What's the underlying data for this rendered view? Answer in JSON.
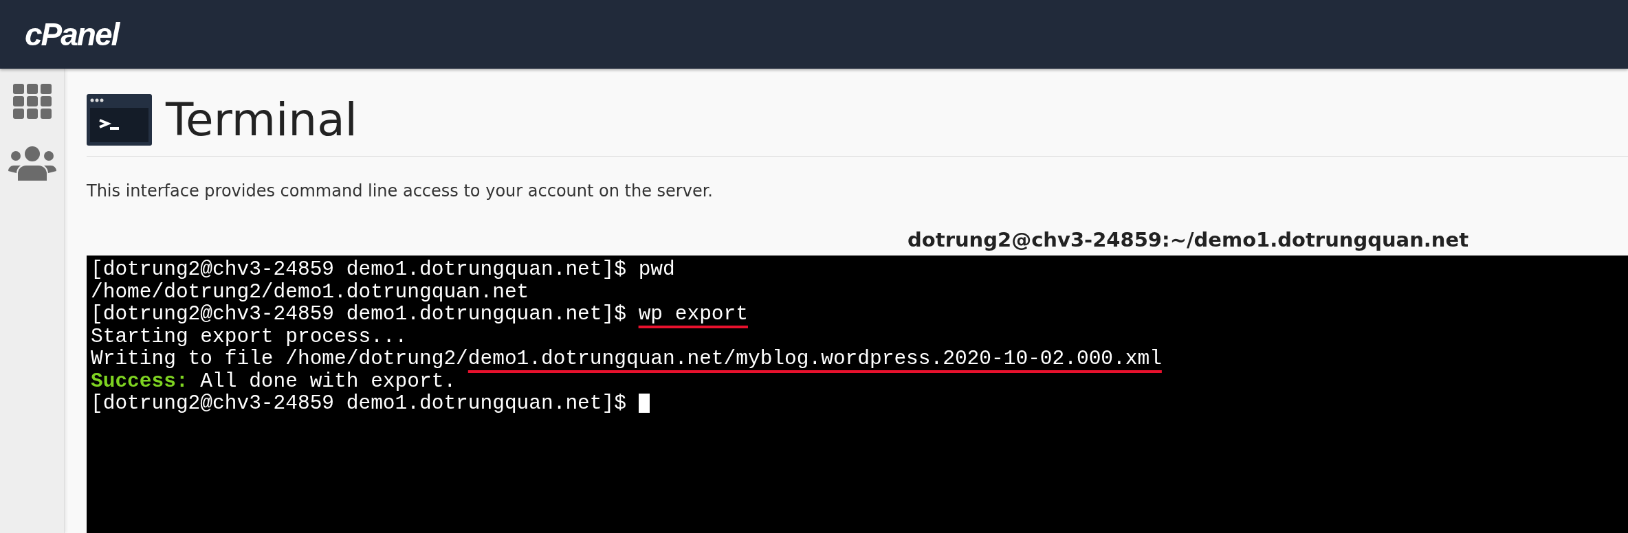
{
  "header": {
    "logo": "cPanel"
  },
  "sidebar": {
    "items": [
      {
        "kind": "grid"
      },
      {
        "kind": "users"
      }
    ]
  },
  "page": {
    "title": "Terminal",
    "description": "This interface provides command line access to your account on the server."
  },
  "terminal": {
    "title": "dotrung2@chv3-24859:~/demo1.dotrungquan.net",
    "lines": [
      {
        "cursor": false,
        "segments": [
          {
            "text": "[dotrung2@chv3-24859 demo1.dotrungquan.net]$ pwd",
            "kind": "output",
            "underlined": false
          }
        ]
      },
      {
        "cursor": false,
        "segments": [
          {
            "text": "/home/dotrung2/demo1.dotrungquan.net",
            "kind": "output",
            "underlined": false
          }
        ]
      },
      {
        "cursor": false,
        "segments": [
          {
            "text": "[dotrung2@chv3-24859 demo1.dotrungquan.net]$ ",
            "kind": "output",
            "underlined": false
          },
          {
            "text": "wp export",
            "kind": "output",
            "underlined": true
          }
        ]
      },
      {
        "cursor": false,
        "segments": [
          {
            "text": "Starting export process...",
            "kind": "output",
            "underlined": false
          }
        ]
      },
      {
        "cursor": false,
        "segments": [
          {
            "text": "Writing to file /home/dotrung2/",
            "kind": "output",
            "underlined": false
          },
          {
            "text": "demo1.dotrungquan.net/myblog.wordpress.2020-10-02.000.xml",
            "kind": "output",
            "underlined": true
          }
        ]
      },
      {
        "cursor": false,
        "segments": [
          {
            "text": "Success:",
            "kind": "success",
            "underlined": false
          },
          {
            "text": " All done with export.",
            "kind": "output",
            "underlined": false
          }
        ]
      },
      {
        "cursor": true,
        "segments": [
          {
            "text": "[dotrung2@chv3-24859 demo1.dotrungquan.net]$ ",
            "kind": "output",
            "underlined": false
          }
        ]
      }
    ]
  }
}
